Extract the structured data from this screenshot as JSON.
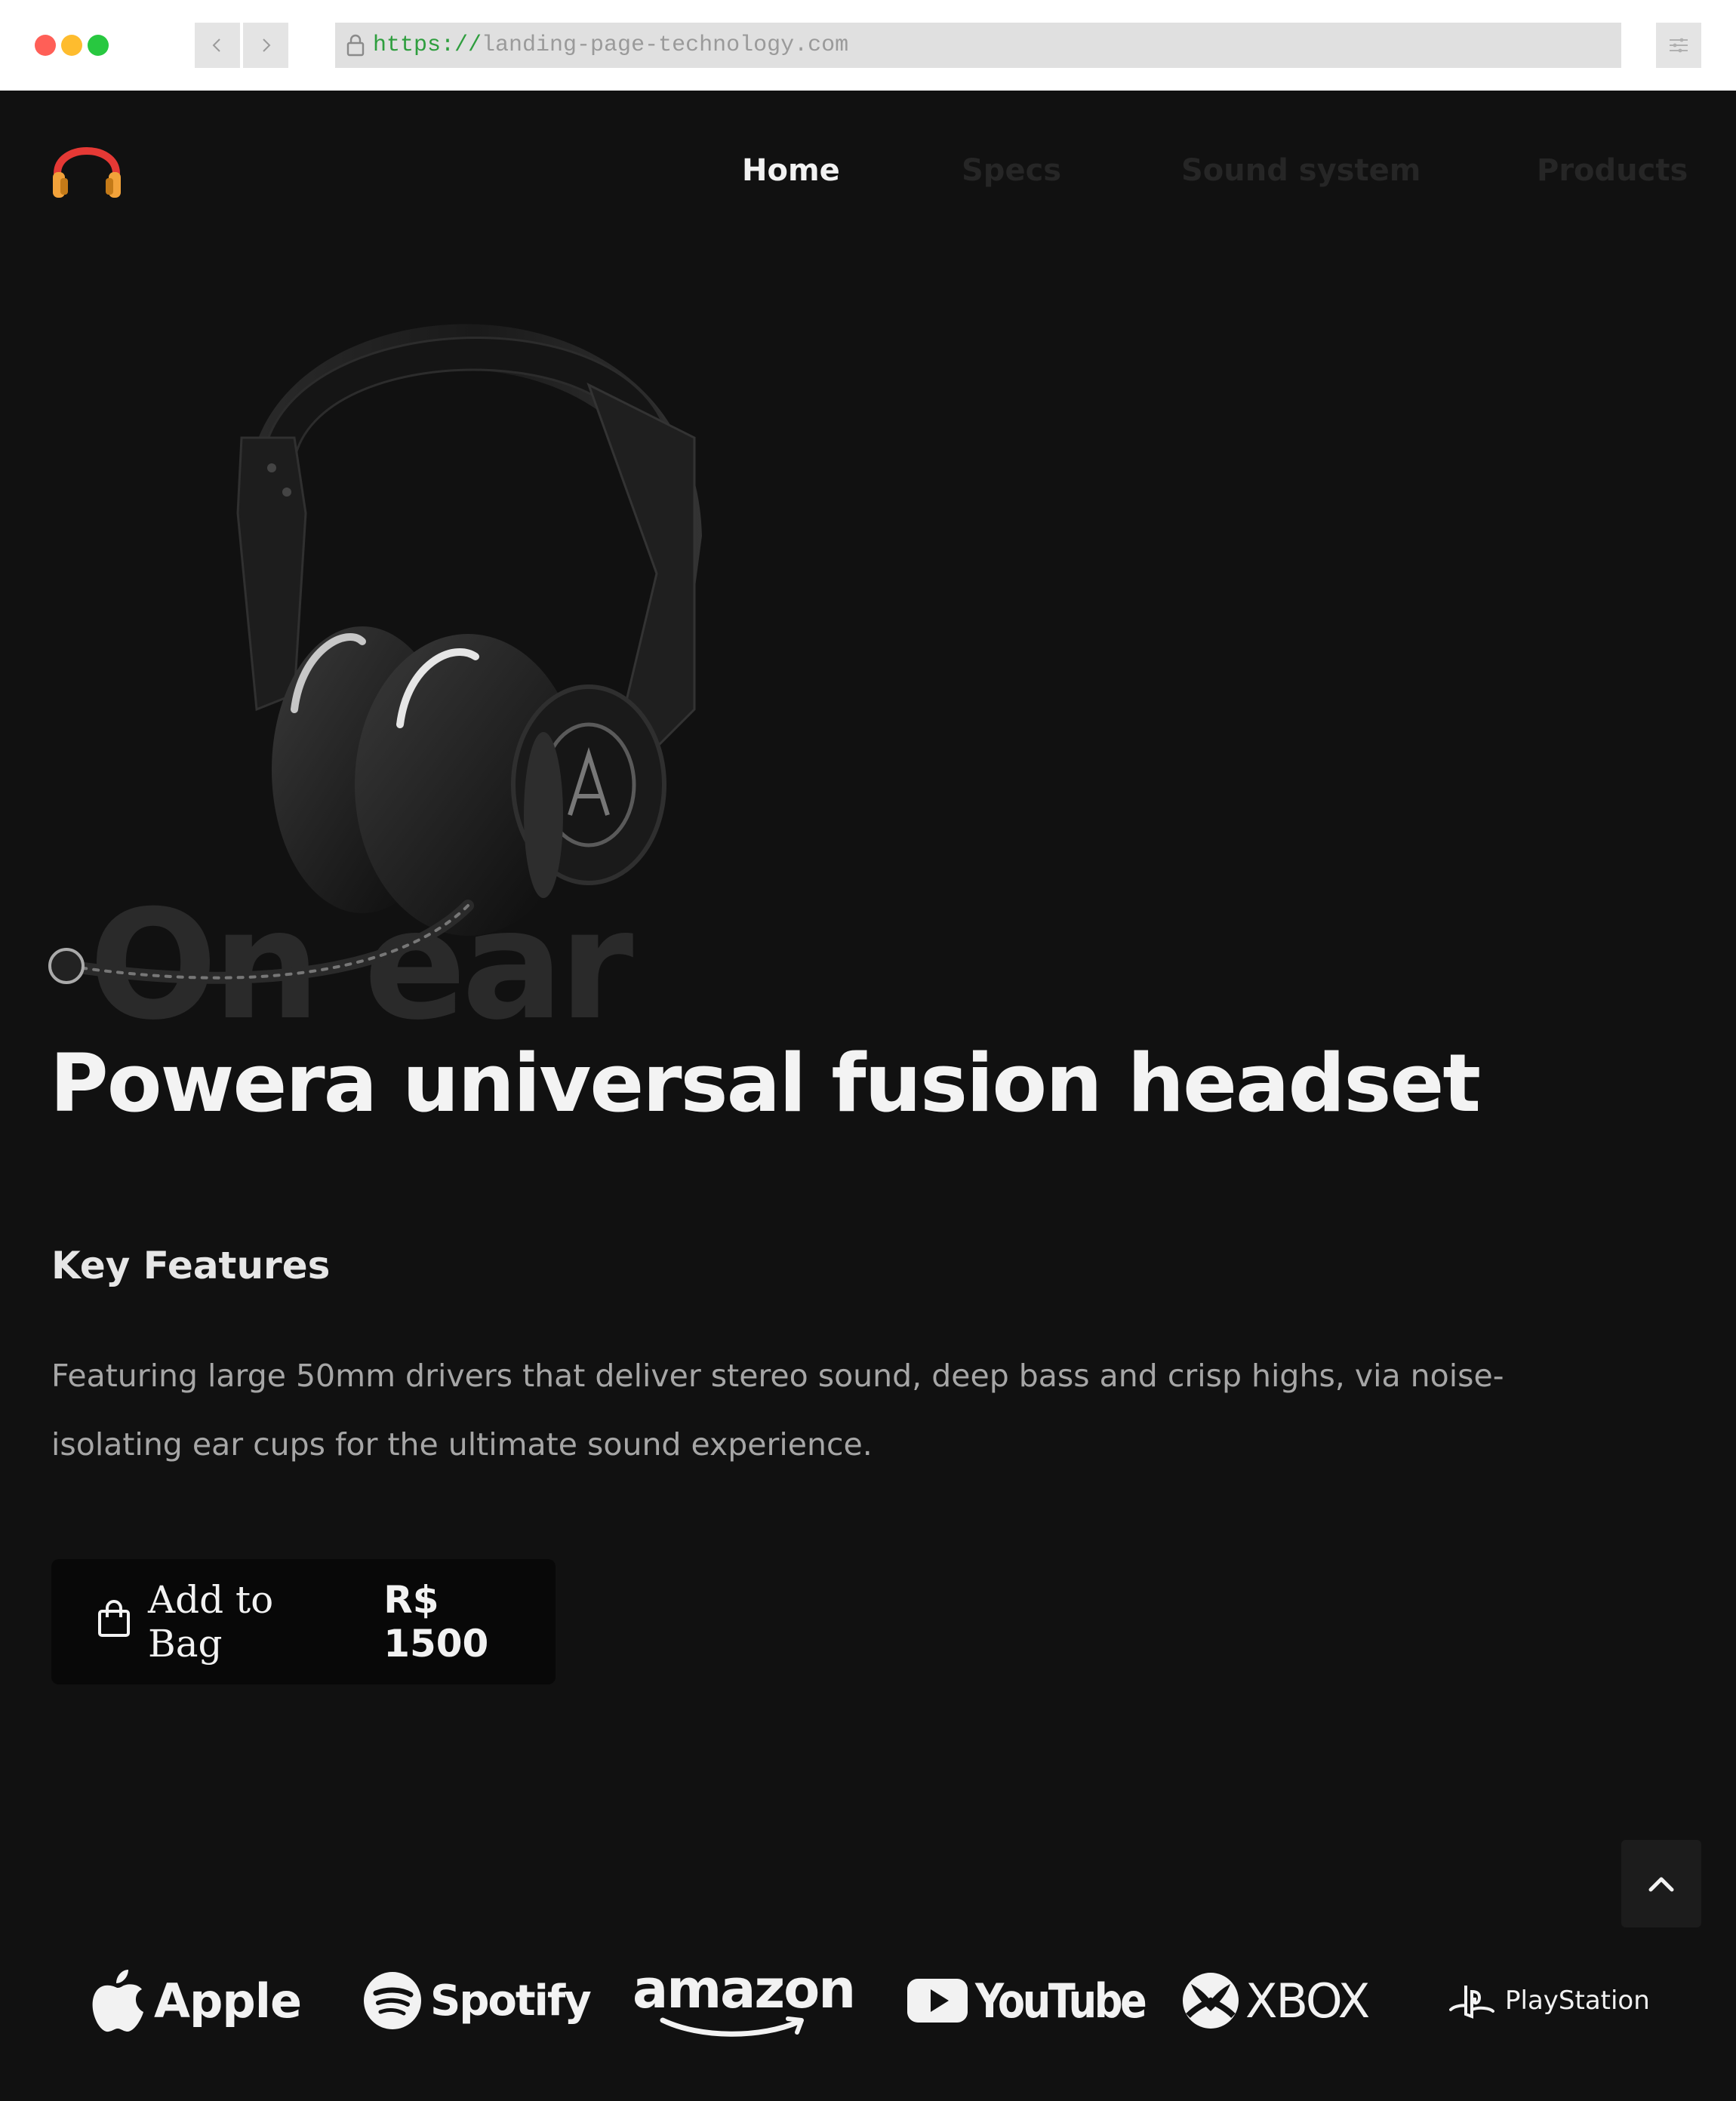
{
  "browser": {
    "url_scheme": "https://",
    "url_host": "landing-page-technology.com",
    "icons": [
      "lock-icon",
      "chevron-left-icon",
      "chevron-right-icon",
      "menu-icon"
    ]
  },
  "header": {
    "logo_icon": "headphones-icon",
    "nav": {
      "home": "Home",
      "specs": "Specs",
      "sound_system": "Sound system",
      "products": "Products"
    }
  },
  "hero": {
    "watermark": "On ear",
    "title": "Powera universal fusion headset",
    "features_heading": "Key Features",
    "features_text": "Featuring large 50mm drivers that deliver stereo sound, deep bass and crisp highs, via noise-isolating ear cups for the ultimate sound experience.",
    "add_to_bag": {
      "label": "Add to Bag",
      "price": "R$ 1500",
      "icon": "shopping-bag-icon"
    },
    "scroll_top_icon": "chevron-up-icon"
  },
  "partners": [
    {
      "name": "Apple",
      "icon": "apple-icon"
    },
    {
      "name": "Spotify",
      "icon": "spotify-icon"
    },
    {
      "name": "amazon",
      "icon": "amazon-smile-icon"
    },
    {
      "name": "YouTube",
      "icon": "youtube-play-icon"
    },
    {
      "name": "XBOX",
      "icon": "xbox-icon"
    },
    {
      "name": "PlayStation",
      "icon": "playstation-icon"
    }
  ],
  "colors": {
    "background": "#111111",
    "text_primary": "#f3f3f3",
    "text_secondary": "#a6a6a6",
    "nav_inactive": "#262626",
    "button_bg": "#080808",
    "logo_red": "#e53935",
    "logo_orange": "#f2a23a"
  }
}
